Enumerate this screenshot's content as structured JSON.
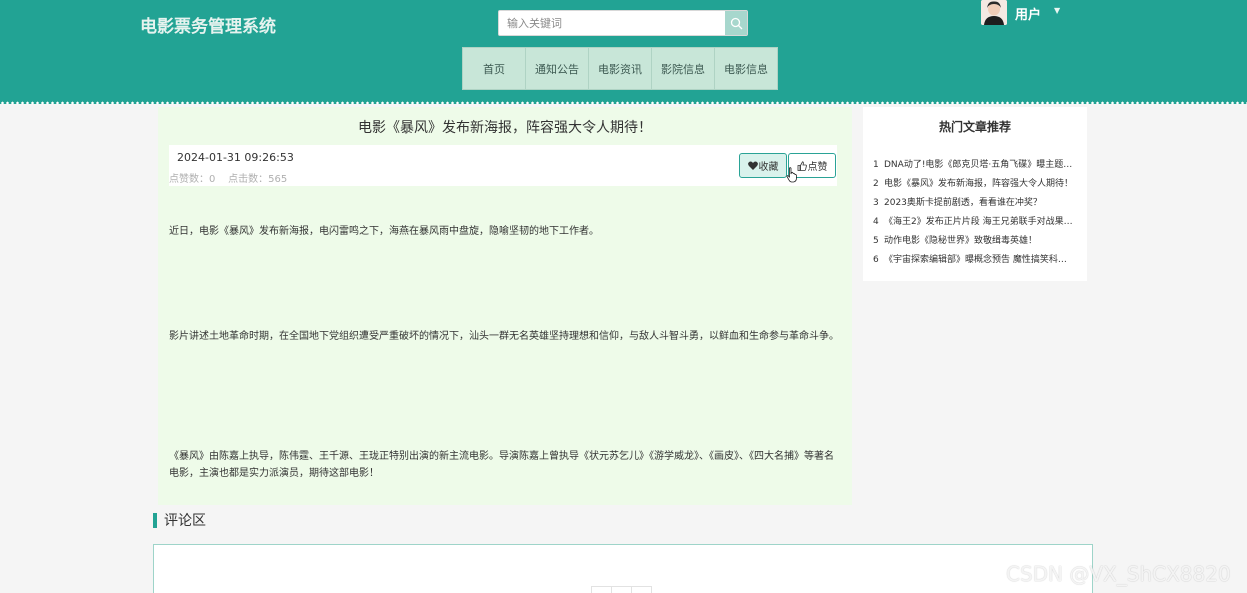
{
  "header": {
    "brand": "电影票务管理系统",
    "search": {
      "placeholder": "输入关键词",
      "value": ""
    },
    "user_label": "用户",
    "nav": [
      "首页",
      "通知公告",
      "电影资讯",
      "影院信息",
      "电影信息"
    ]
  },
  "article": {
    "title": "电影《暴风》发布新海报，阵容强大令人期待！",
    "date": "2024-01-31 09:26:53",
    "likes_label": "点赞数：0",
    "clicks_label": "点击数：565",
    "favorite_label": "收藏",
    "like_label": "点赞",
    "paragraphs": [
      "近日，电影《暴风》发布新海报，电闪雷鸣之下，海燕在暴风雨中盘旋，隐喻坚韧的地下工作者。",
      "影片讲述土地革命时期，在全国地下党组织遭受严重破坏的情况下，汕头一群无名英雄坚持理想和信仰，与敌人斗智斗勇，以鲜血和生命参与革命斗争。",
      "《暴风》由陈嘉上执导，陈伟霆、王千源、王珑正特别出演的新主流电影。导演陈嘉上曾执导《状元苏乞儿》《游学威龙》、《画皮》、《四大名捕》等著名电影，主演也都是实力派演员，期待这部电影！"
    ]
  },
  "sidebar": {
    "title": "热门文章推荐",
    "items": [
      {
        "num": "1",
        "text": "DNA动了!电影《郎克贝塔·五角飞碟》曝主题…"
      },
      {
        "num": "2",
        "text": "电影《暴风》发布新海报，阵容强大令人期待！"
      },
      {
        "num": "3",
        "text": "2023奥斯卡提前剧透，看看谁在冲奖？"
      },
      {
        "num": "4",
        "text": "《海王2》发布正片片段 海王兄弟联手对战果…"
      },
      {
        "num": "5",
        "text": "动作电影《隐秘世界》致敬缉毒英雄！"
      },
      {
        "num": "6",
        "text": "《宇宙探索编辑部》曝概念预告 魔性搞笑科…"
      }
    ]
  },
  "comments": {
    "title": "评论区"
  },
  "watermark": "CSDN @VX_ShCX8820",
  "colors": {
    "primary": "#22a394",
    "article_bg": "#eefbe9",
    "nav_bg": "#c8e6d8"
  }
}
